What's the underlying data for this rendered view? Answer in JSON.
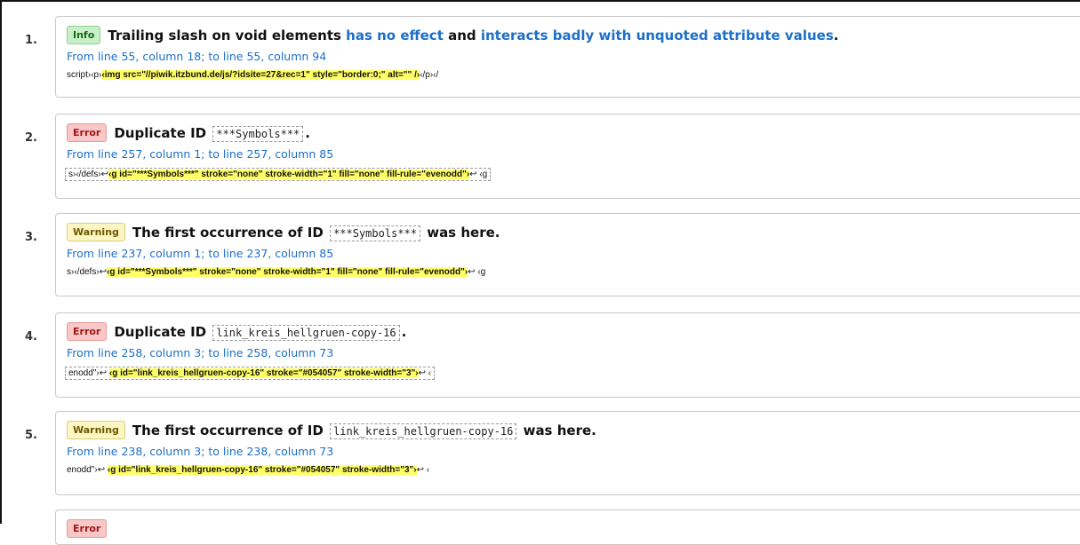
{
  "messages": [
    {
      "number": "1.",
      "type": "Info",
      "parts": [
        {
          "text": "Trailing slash on void elements ",
          "style": "plain"
        },
        {
          "text": "has no effect",
          "style": "link"
        },
        {
          "text": " and ",
          "style": "plain"
        },
        {
          "text": "interacts badly with unquoted attribute values",
          "style": "link"
        },
        {
          "text": ".",
          "style": "plain"
        }
      ],
      "location": "From line 55, column 18; to line 55, column 94",
      "extract_before": "script›‹p›",
      "extract_highlight": "‹img src=\"//piwik.itzbund.de/js/?idsite=27&rec=1\" style=\"border:0;\" alt=\"\" /›",
      "extract_after": "‹/p›‹/"
    },
    {
      "number": "2.",
      "type": "Error",
      "parts": [
        {
          "text": "Duplicate ID ",
          "style": "plain"
        },
        {
          "text": "***Symbols***",
          "style": "code"
        },
        {
          "text": ".",
          "style": "plain"
        }
      ],
      "location": "From line 257, column 1; to line 257, column 85",
      "extract_before": "s›‹/defs›↩",
      "extract_highlight": "‹g id=\"***Symbols***\" stroke=\"none\" stroke-width=\"1\" fill=\"none\" fill-rule=\"evenodd\"›",
      "extract_after": "↩ ‹g"
    },
    {
      "number": "3.",
      "type": "Warning",
      "parts": [
        {
          "text": "The first occurrence of ID ",
          "style": "plain"
        },
        {
          "text": "***Symbols***",
          "style": "code"
        },
        {
          "text": " was here.",
          "style": "plain"
        }
      ],
      "location": "From line 237, column 1; to line 237, column 85",
      "extract_before": "s›‹/defs›↩",
      "extract_highlight": "‹g id=\"***Symbols***\" stroke=\"none\" stroke-width=\"1\" fill=\"none\" fill-rule=\"evenodd\"›",
      "extract_after": "↩ ‹g"
    },
    {
      "number": "4.",
      "type": "Error",
      "parts": [
        {
          "text": "Duplicate ID ",
          "style": "plain"
        },
        {
          "text": "link_kreis_hellgruen-copy-16",
          "style": "code"
        },
        {
          "text": ".",
          "style": "plain"
        }
      ],
      "location": "From line 258, column 3; to line 258, column 73",
      "extract_before": "enodd\"›↩ ",
      "extract_highlight": "‹g id=\"link_kreis_hellgruen-copy-16\" stroke=\"#054057\" stroke-width=\"3\"›",
      "extract_after": "↩ ‹"
    },
    {
      "number": "5.",
      "type": "Warning",
      "parts": [
        {
          "text": "The first occurrence of ID ",
          "style": "plain"
        },
        {
          "text": "link_kreis_hellgruen-copy-16",
          "style": "code"
        },
        {
          "text": " was here.",
          "style": "plain"
        }
      ],
      "location": "From line 238, column 3; to line 238, column 73",
      "extract_before": "enodd\"›↩ ",
      "extract_highlight": "‹g id=\"link_kreis_hellgruen-copy-16\" stroke=\"#054057\" stroke-width=\"3\"›",
      "extract_after": "↩ ‹"
    },
    {
      "number": "",
      "type": "Error",
      "parts": [],
      "location": "",
      "extract_before": "",
      "extract_highlight": "",
      "extract_after": ""
    }
  ],
  "colors": {
    "info_badge": "#c8f0c8",
    "error_badge": "#f8c7c7",
    "warning_badge": "#fcf5c4",
    "link": "#1d6fc8",
    "highlight": "#ffff66"
  }
}
